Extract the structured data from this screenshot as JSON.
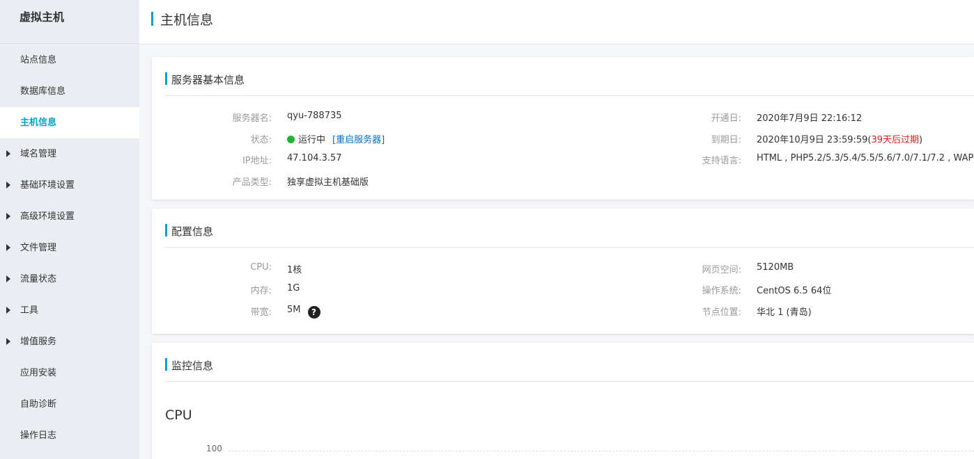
{
  "sidebar": {
    "title": "虚拟主机",
    "items": [
      {
        "label": "站点信息",
        "expandable": false,
        "active": false
      },
      {
        "label": "数据库信息",
        "expandable": false,
        "active": false
      },
      {
        "label": "主机信息",
        "expandable": false,
        "active": true
      },
      {
        "label": "域名管理",
        "expandable": true,
        "active": false
      },
      {
        "label": "基础环境设置",
        "expandable": true,
        "active": false
      },
      {
        "label": "高级环境设置",
        "expandable": true,
        "active": false
      },
      {
        "label": "文件管理",
        "expandable": true,
        "active": false
      },
      {
        "label": "流量状态",
        "expandable": true,
        "active": false
      },
      {
        "label": "工具",
        "expandable": true,
        "active": false
      },
      {
        "label": "增值服务",
        "expandable": true,
        "active": false
      },
      {
        "label": "应用安装",
        "expandable": false,
        "active": false
      },
      {
        "label": "自助诊断",
        "expandable": false,
        "active": false
      },
      {
        "label": "操作日志",
        "expandable": false,
        "active": false
      }
    ]
  },
  "header": {
    "title": "主机信息"
  },
  "basic": {
    "title": "服务器基本信息",
    "server_name_label": "服务器名:",
    "server_name": "qyu-788735",
    "status_label": "状态:",
    "status": "运行中",
    "restart_link": "[重启服务器]",
    "ip_label": "IP地址:",
    "ip": "47.104.3.57",
    "product_label": "产品类型:",
    "product": "独享虚拟主机基础版",
    "open_label": "开通日:",
    "open_date": "2020年7月9日 22:16:12",
    "expire_label": "到期日:",
    "expire_date": "2020年10月9日 23:59:59",
    "expire_open_paren": "(",
    "expire_note": "39天后过期",
    "expire_close_paren": ")",
    "lang_label": "支持语言:",
    "langs": "HTML , PHP5.2/5.3/5.4/5.5/5.6/7.0/7.1/7.2 , WAP"
  },
  "config": {
    "title": "配置信息",
    "cpu_label": "CPU:",
    "cpu": "1核",
    "mem_label": "内存:",
    "mem": "1G",
    "bw_label": "带宽:",
    "bw": "5M",
    "help_icon": "?",
    "web_label": "网页空间:",
    "web": "5120MB",
    "os_label": "操作系统:",
    "os": "CentOS 6.5 64位",
    "node_label": "节点位置:",
    "node": "华北 1 (青岛)"
  },
  "monitor": {
    "title": "监控信息",
    "chart_title": "CPU",
    "y_tick_top": "100"
  },
  "colors": {
    "accent": "#00a2ca",
    "status_running": "#1fb532",
    "link": "#0070cc",
    "warning": "#e02020"
  }
}
